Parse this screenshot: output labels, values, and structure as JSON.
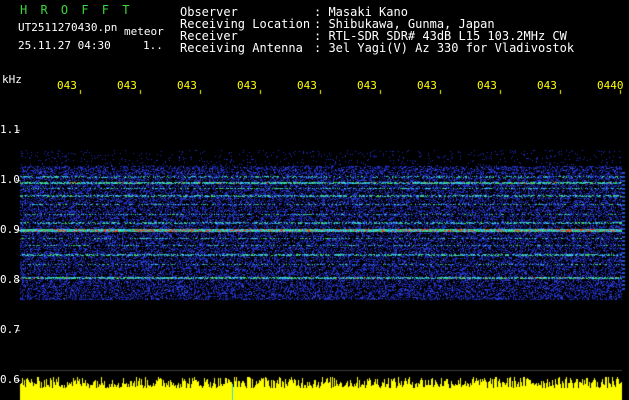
{
  "header": {
    "title": "H R O F F T",
    "filename": "UT2511270430.pn",
    "mode": "meteor",
    "datetime": "25.11.27 04:30",
    "sequence": "1.."
  },
  "info": [
    {
      "label": "Observer",
      "value": "Masaki Kano"
    },
    {
      "label": "Receiving Location",
      "value": "Shibukawa, Gunma, Japan"
    },
    {
      "label": "Receiver",
      "value": "RTL-SDR SDR# 43dB L15 103.2MHz CW"
    },
    {
      "label": "Receiving Antenna",
      "value": "3el Yagi(V) Az 330 for Vladivostok"
    }
  ],
  "plot": {
    "freq_unit": "kHz",
    "time_ticks": [
      "043",
      "043",
      "043",
      "043",
      "043",
      "043",
      "043",
      "043",
      "043",
      "0440"
    ],
    "freq_ticks": [
      "1.1",
      "1.0",
      "0.9",
      "0.8",
      "0.7",
      "0.6"
    ],
    "colors": {
      "background": "#000000",
      "noise": "#1e2dbe",
      "signal_cyan": "#3ad8e0",
      "signal_green": "#3cd83c",
      "signal_red": "#e83a2a",
      "level_trace": "#ffff00",
      "axis_tick": "#ffff00"
    }
  }
}
